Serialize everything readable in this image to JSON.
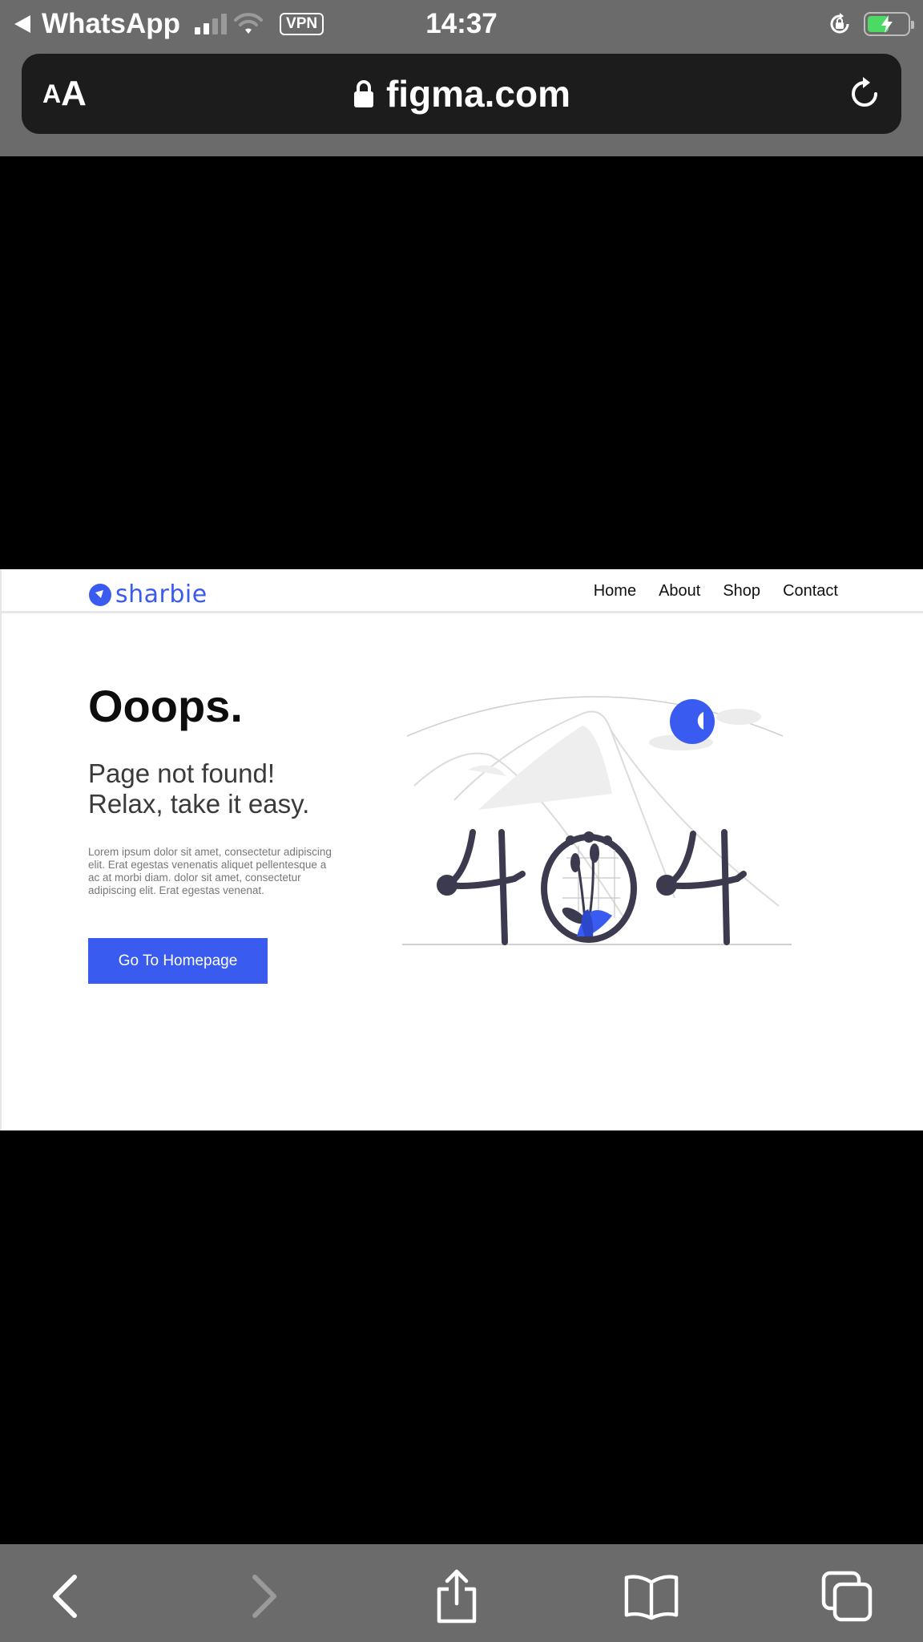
{
  "status_bar": {
    "back_app": "WhatsApp",
    "vpn": "VPN",
    "time": "14:37"
  },
  "browser": {
    "text_size_small": "A",
    "text_size_large": "A",
    "url": "figma.com"
  },
  "site": {
    "logo_text": "sharbie",
    "nav": [
      "Home",
      "About",
      "Shop",
      "Contact"
    ],
    "title": "Ooops.",
    "subtitle": "Page not found! Relax, take it easy.",
    "body": "Lorem ipsum dolor sit amet, consectetur adipiscing elit. Erat egestas venenatis aliquet pellentesque a ac at morbi diam. dolor sit amet, consectetur adipiscing elit. Erat egestas venenat.",
    "cta_label": "Go To Homepage",
    "illustration_text": "404"
  },
  "colors": {
    "accent": "#3a5bf0",
    "chrome": "#6b6b6b",
    "url_bar": "#1c1c1c"
  },
  "icons": {
    "back": "chevron-left-icon",
    "forward": "chevron-right-icon",
    "share": "share-icon",
    "bookmarks": "book-icon",
    "tabs": "tabs-icon",
    "lock": "lock-icon",
    "reload": "reload-icon"
  }
}
